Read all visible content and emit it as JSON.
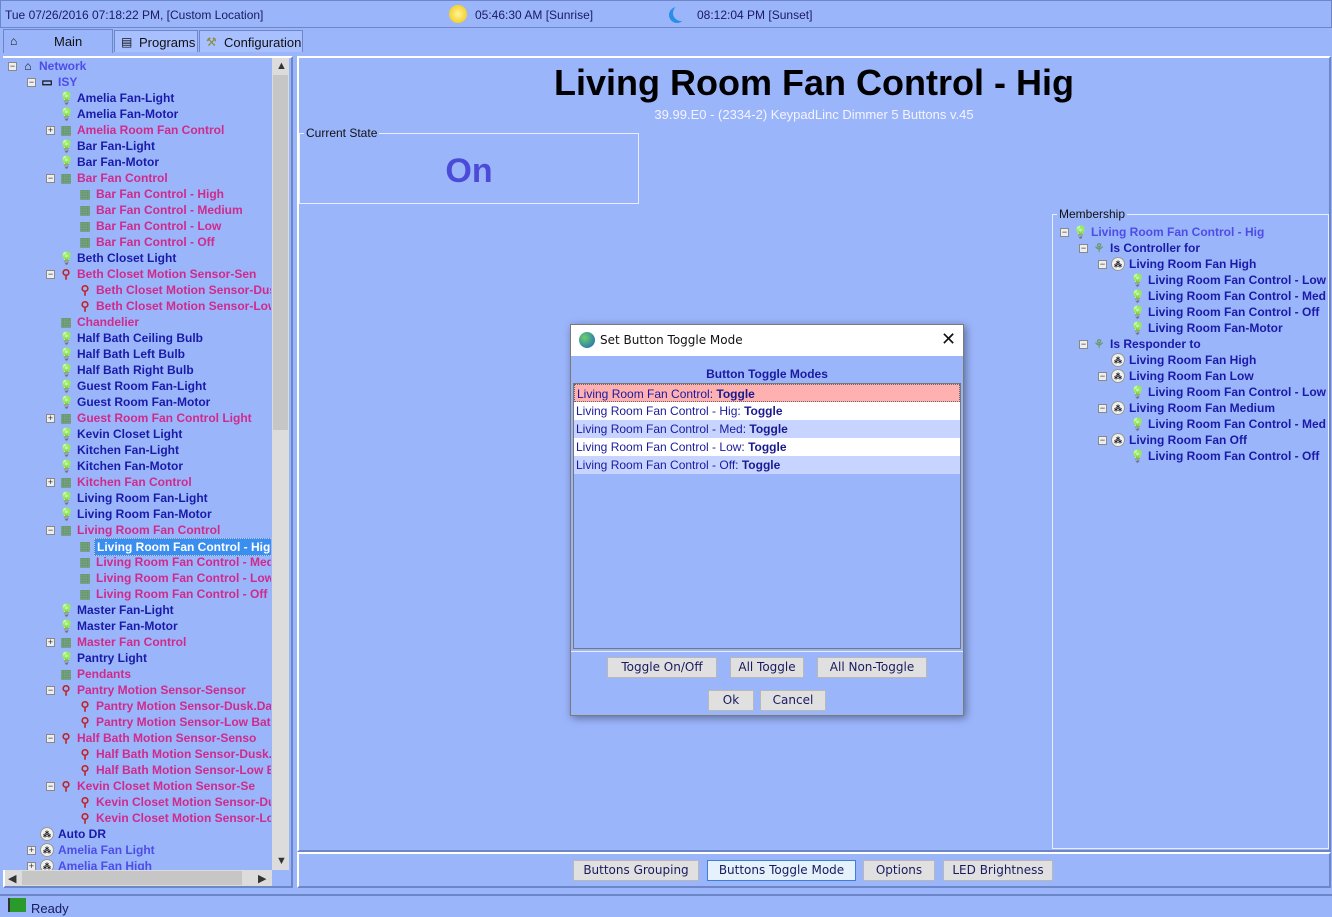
{
  "topbar": {
    "datetime": "Tue 07/26/2016 07:18:22 PM,  [Custom Location]",
    "sunrise": "05:46:30 AM [Sunrise]",
    "sunset": "08:12:04 PM [Sunset]"
  },
  "tabs": [
    {
      "label": "Main",
      "icon": "home-icon"
    },
    {
      "label": "Programs",
      "icon": "programs-icon"
    },
    {
      "label": "Configuration",
      "icon": "configuration-icon"
    }
  ],
  "tree": [
    [
      "Network",
      0,
      "-",
      "house",
      "lnk"
    ],
    [
      "ISY",
      1,
      "-",
      "computer",
      "lnk"
    ],
    [
      "Amelia Fan-Light",
      2,
      "",
      "bulb",
      "dev"
    ],
    [
      "Amelia Fan-Motor",
      2,
      "",
      "bulb",
      "dev"
    ],
    [
      "Amelia Room Fan Control",
      2,
      "+",
      "keypad",
      "mag"
    ],
    [
      "Bar Fan-Light",
      2,
      "",
      "bulb",
      "dev"
    ],
    [
      "Bar Fan-Motor",
      2,
      "",
      "bulb",
      "dev"
    ],
    [
      "Bar Fan Control",
      2,
      "-",
      "keypad",
      "mag"
    ],
    [
      "Bar Fan Control - High",
      3,
      "",
      "keypad",
      "mag"
    ],
    [
      "Bar Fan Control - Medium",
      3,
      "",
      "keypad",
      "mag"
    ],
    [
      "Bar Fan Control - Low",
      3,
      "",
      "keypad",
      "mag"
    ],
    [
      "Bar Fan Control - Off",
      3,
      "",
      "keypad",
      "mag"
    ],
    [
      "Beth Closet Light",
      2,
      "",
      "bulb",
      "dev"
    ],
    [
      "Beth Closet Motion Sensor-Sen",
      2,
      "-",
      "sensor",
      "mag"
    ],
    [
      "Beth Closet Motion Sensor-Dus",
      3,
      "",
      "sensor",
      "mag"
    ],
    [
      "Beth Closet Motion Sensor-Low",
      3,
      "",
      "sensor",
      "mag"
    ],
    [
      "Chandelier",
      2,
      "",
      "keypad",
      "mag"
    ],
    [
      "Half Bath Ceiling Bulb",
      2,
      "",
      "bulb",
      "dev"
    ],
    [
      "Half Bath Left Bulb",
      2,
      "",
      "bulb",
      "dev"
    ],
    [
      "Half Bath Right Bulb",
      2,
      "",
      "bulb",
      "dev"
    ],
    [
      "Guest Room Fan-Light",
      2,
      "",
      "bulb",
      "dev"
    ],
    [
      "Guest Room Fan-Motor",
      2,
      "",
      "bulb",
      "dev"
    ],
    [
      "Guest Room Fan Control Light",
      2,
      "+",
      "keypad",
      "mag"
    ],
    [
      "Kevin Closet Light",
      2,
      "",
      "bulb",
      "dev"
    ],
    [
      "Kitchen Fan-Light",
      2,
      "",
      "bulb",
      "dev"
    ],
    [
      "Kitchen Fan-Motor",
      2,
      "",
      "bulb",
      "dev"
    ],
    [
      "Kitchen Fan Control",
      2,
      "+",
      "keypad",
      "mag"
    ],
    [
      "Living Room Fan-Light",
      2,
      "",
      "bulb",
      "dev"
    ],
    [
      "Living Room Fan-Motor",
      2,
      "",
      "bulb",
      "dev"
    ],
    [
      "Living Room Fan Control",
      2,
      "-",
      "keypad",
      "mag"
    ],
    [
      "Living Room Fan Control - Hig",
      3,
      "",
      "keypad",
      "sel"
    ],
    [
      "Living Room Fan Control - Med",
      3,
      "",
      "keypad",
      "mag"
    ],
    [
      "Living Room Fan Control - Low",
      3,
      "",
      "keypad",
      "mag"
    ],
    [
      "Living Room Fan Control - Off",
      3,
      "",
      "keypad",
      "mag"
    ],
    [
      "Master Fan-Light",
      2,
      "",
      "bulb",
      "dev"
    ],
    [
      "Master Fan-Motor",
      2,
      "",
      "bulb",
      "dev"
    ],
    [
      "Master Fan Control",
      2,
      "+",
      "keypad",
      "mag"
    ],
    [
      "Pantry Light",
      2,
      "",
      "bulb",
      "dev"
    ],
    [
      "Pendants",
      2,
      "",
      "keypad",
      "mag"
    ],
    [
      "Pantry Motion Sensor-Sensor",
      2,
      "-",
      "sensor",
      "mag"
    ],
    [
      "Pantry Motion Sensor-Dusk.Da",
      3,
      "",
      "sensor",
      "mag"
    ],
    [
      "Pantry Motion Sensor-Low Bat",
      3,
      "",
      "sensor",
      "mag"
    ],
    [
      "Half Bath Motion Sensor-Senso",
      2,
      "-",
      "sensor",
      "mag"
    ],
    [
      "Half Bath Motion Sensor-Dusk.",
      3,
      "",
      "sensor",
      "mag"
    ],
    [
      "Half Bath Motion Sensor-Low B",
      3,
      "",
      "sensor",
      "mag"
    ],
    [
      "Kevin Closet Motion Sensor-Se",
      2,
      "-",
      "sensor",
      "mag"
    ],
    [
      "Kevin Closet Motion Sensor-Du",
      3,
      "",
      "sensor",
      "mag"
    ],
    [
      "Kevin Closet Motion Sensor-Lo",
      3,
      "",
      "sensor",
      "mag"
    ],
    [
      "Auto DR",
      1,
      "",
      "scene",
      "dev"
    ],
    [
      "Amelia Fan Light",
      1,
      "+",
      "scene",
      "lnk"
    ],
    [
      "Amelia Fan High",
      1,
      "+",
      "scene",
      "lnk"
    ]
  ],
  "device": {
    "title": "Living Room Fan Control - Hig",
    "subtitle": "39.99.E0  -  (2334-2) KeypadLinc Dimmer 5 Buttons v.45",
    "current_state_label": "Current State",
    "current_state": "On"
  },
  "membership": {
    "label": "Membership",
    "tree": [
      [
        "Living Room Fan Control - Hig",
        0,
        "-",
        "bulb",
        "lnk"
      ],
      [
        "Is Controller for",
        1,
        "-",
        "link",
        "dev"
      ],
      [
        "Living Room Fan High",
        2,
        "-",
        "scene",
        "dev"
      ],
      [
        "Living Room Fan Control - Low",
        3,
        "",
        "bulb",
        "dev"
      ],
      [
        "Living Room Fan Control - Med",
        3,
        "",
        "bulb",
        "dev"
      ],
      [
        "Living Room Fan Control - Off",
        3,
        "",
        "bulb",
        "dev"
      ],
      [
        "Living Room Fan-Motor",
        3,
        "",
        "bulb",
        "dev"
      ],
      [
        "Is Responder to",
        1,
        "-",
        "link",
        "dev"
      ],
      [
        "Living Room Fan High",
        2,
        "",
        "scene",
        "dev"
      ],
      [
        "Living Room Fan Low",
        2,
        "-",
        "scene",
        "dev"
      ],
      [
        "Living Room Fan Control - Low",
        3,
        "",
        "bulb",
        "dev"
      ],
      [
        "Living Room Fan Medium",
        2,
        "-",
        "scene",
        "dev"
      ],
      [
        "Living Room Fan Control - Med",
        3,
        "",
        "bulb",
        "dev"
      ],
      [
        "Living Room Fan Off",
        2,
        "-",
        "scene",
        "dev"
      ],
      [
        "Living Room Fan Control - Off",
        3,
        "",
        "bulb",
        "dev"
      ]
    ]
  },
  "bottom_buttons": [
    "Buttons Grouping",
    "Buttons Toggle Mode",
    "Options",
    "LED Brightness"
  ],
  "status": "Ready",
  "dialog": {
    "title": "Set Button Toggle Mode",
    "heading": "Button Toggle Modes",
    "modes": [
      {
        "name": "Living Room Fan Control: ",
        "mode": "Toggle"
      },
      {
        "name": "Living Room Fan Control - Hig: ",
        "mode": "Toggle"
      },
      {
        "name": "Living Room Fan Control - Med: ",
        "mode": "Toggle"
      },
      {
        "name": "Living Room Fan Control - Low: ",
        "mode": "Toggle"
      },
      {
        "name": "Living Room Fan Control - Off: ",
        "mode": "Toggle"
      }
    ],
    "buttons": [
      "Toggle On/Off",
      "All Toggle",
      "All Non-Toggle"
    ],
    "ok": "Ok",
    "cancel": "Cancel"
  },
  "colors": {
    "background": "#9bb5fb",
    "device": "#1a1aa8",
    "folder": "#d02a8c",
    "link": "#4d4de6",
    "selected": "#3a8ef0"
  }
}
